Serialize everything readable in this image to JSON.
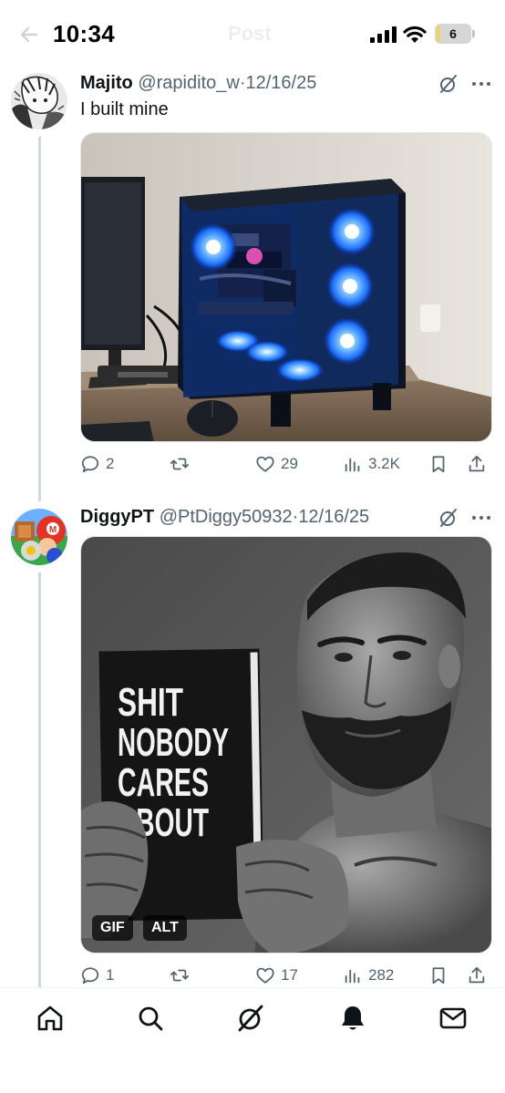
{
  "status_bar": {
    "time": "10:34",
    "battery_level": "6",
    "battery_fraction": 0.06
  },
  "header": {
    "title": "Post",
    "back_icon": "arrow-left-icon"
  },
  "tweets": [
    {
      "display_name": "Majito",
      "handle": "@rapidito_w",
      "separator": "·",
      "date": "12/16/25",
      "text": "I built mine",
      "media_type": "photo",
      "stats": {
        "replies": "2",
        "retweets": "",
        "likes": "29",
        "views": "3.2K"
      }
    },
    {
      "display_name": "DiggyPT",
      "handle": "@PtDiggy50932",
      "separator": "·",
      "date": "12/16/25",
      "text": "",
      "media_type": "gif",
      "media_badges": {
        "gif": "GIF",
        "alt": "ALT"
      },
      "book_text": [
        "SHIT",
        "NOBODY",
        "CARES",
        "ABOUT"
      ],
      "stats": {
        "replies": "1",
        "retweets": "",
        "likes": "17",
        "views": "282"
      }
    }
  ],
  "bottom_nav": {
    "items": [
      "home-icon",
      "search-icon",
      "grok-icon",
      "notifications-icon",
      "messages-icon"
    ]
  },
  "colors": {
    "text_primary": "#0f1419",
    "text_secondary": "#536471",
    "thread_line": "#cfd9de",
    "battery": "#f3d35a",
    "rgb_fan": "#2f8cff"
  }
}
